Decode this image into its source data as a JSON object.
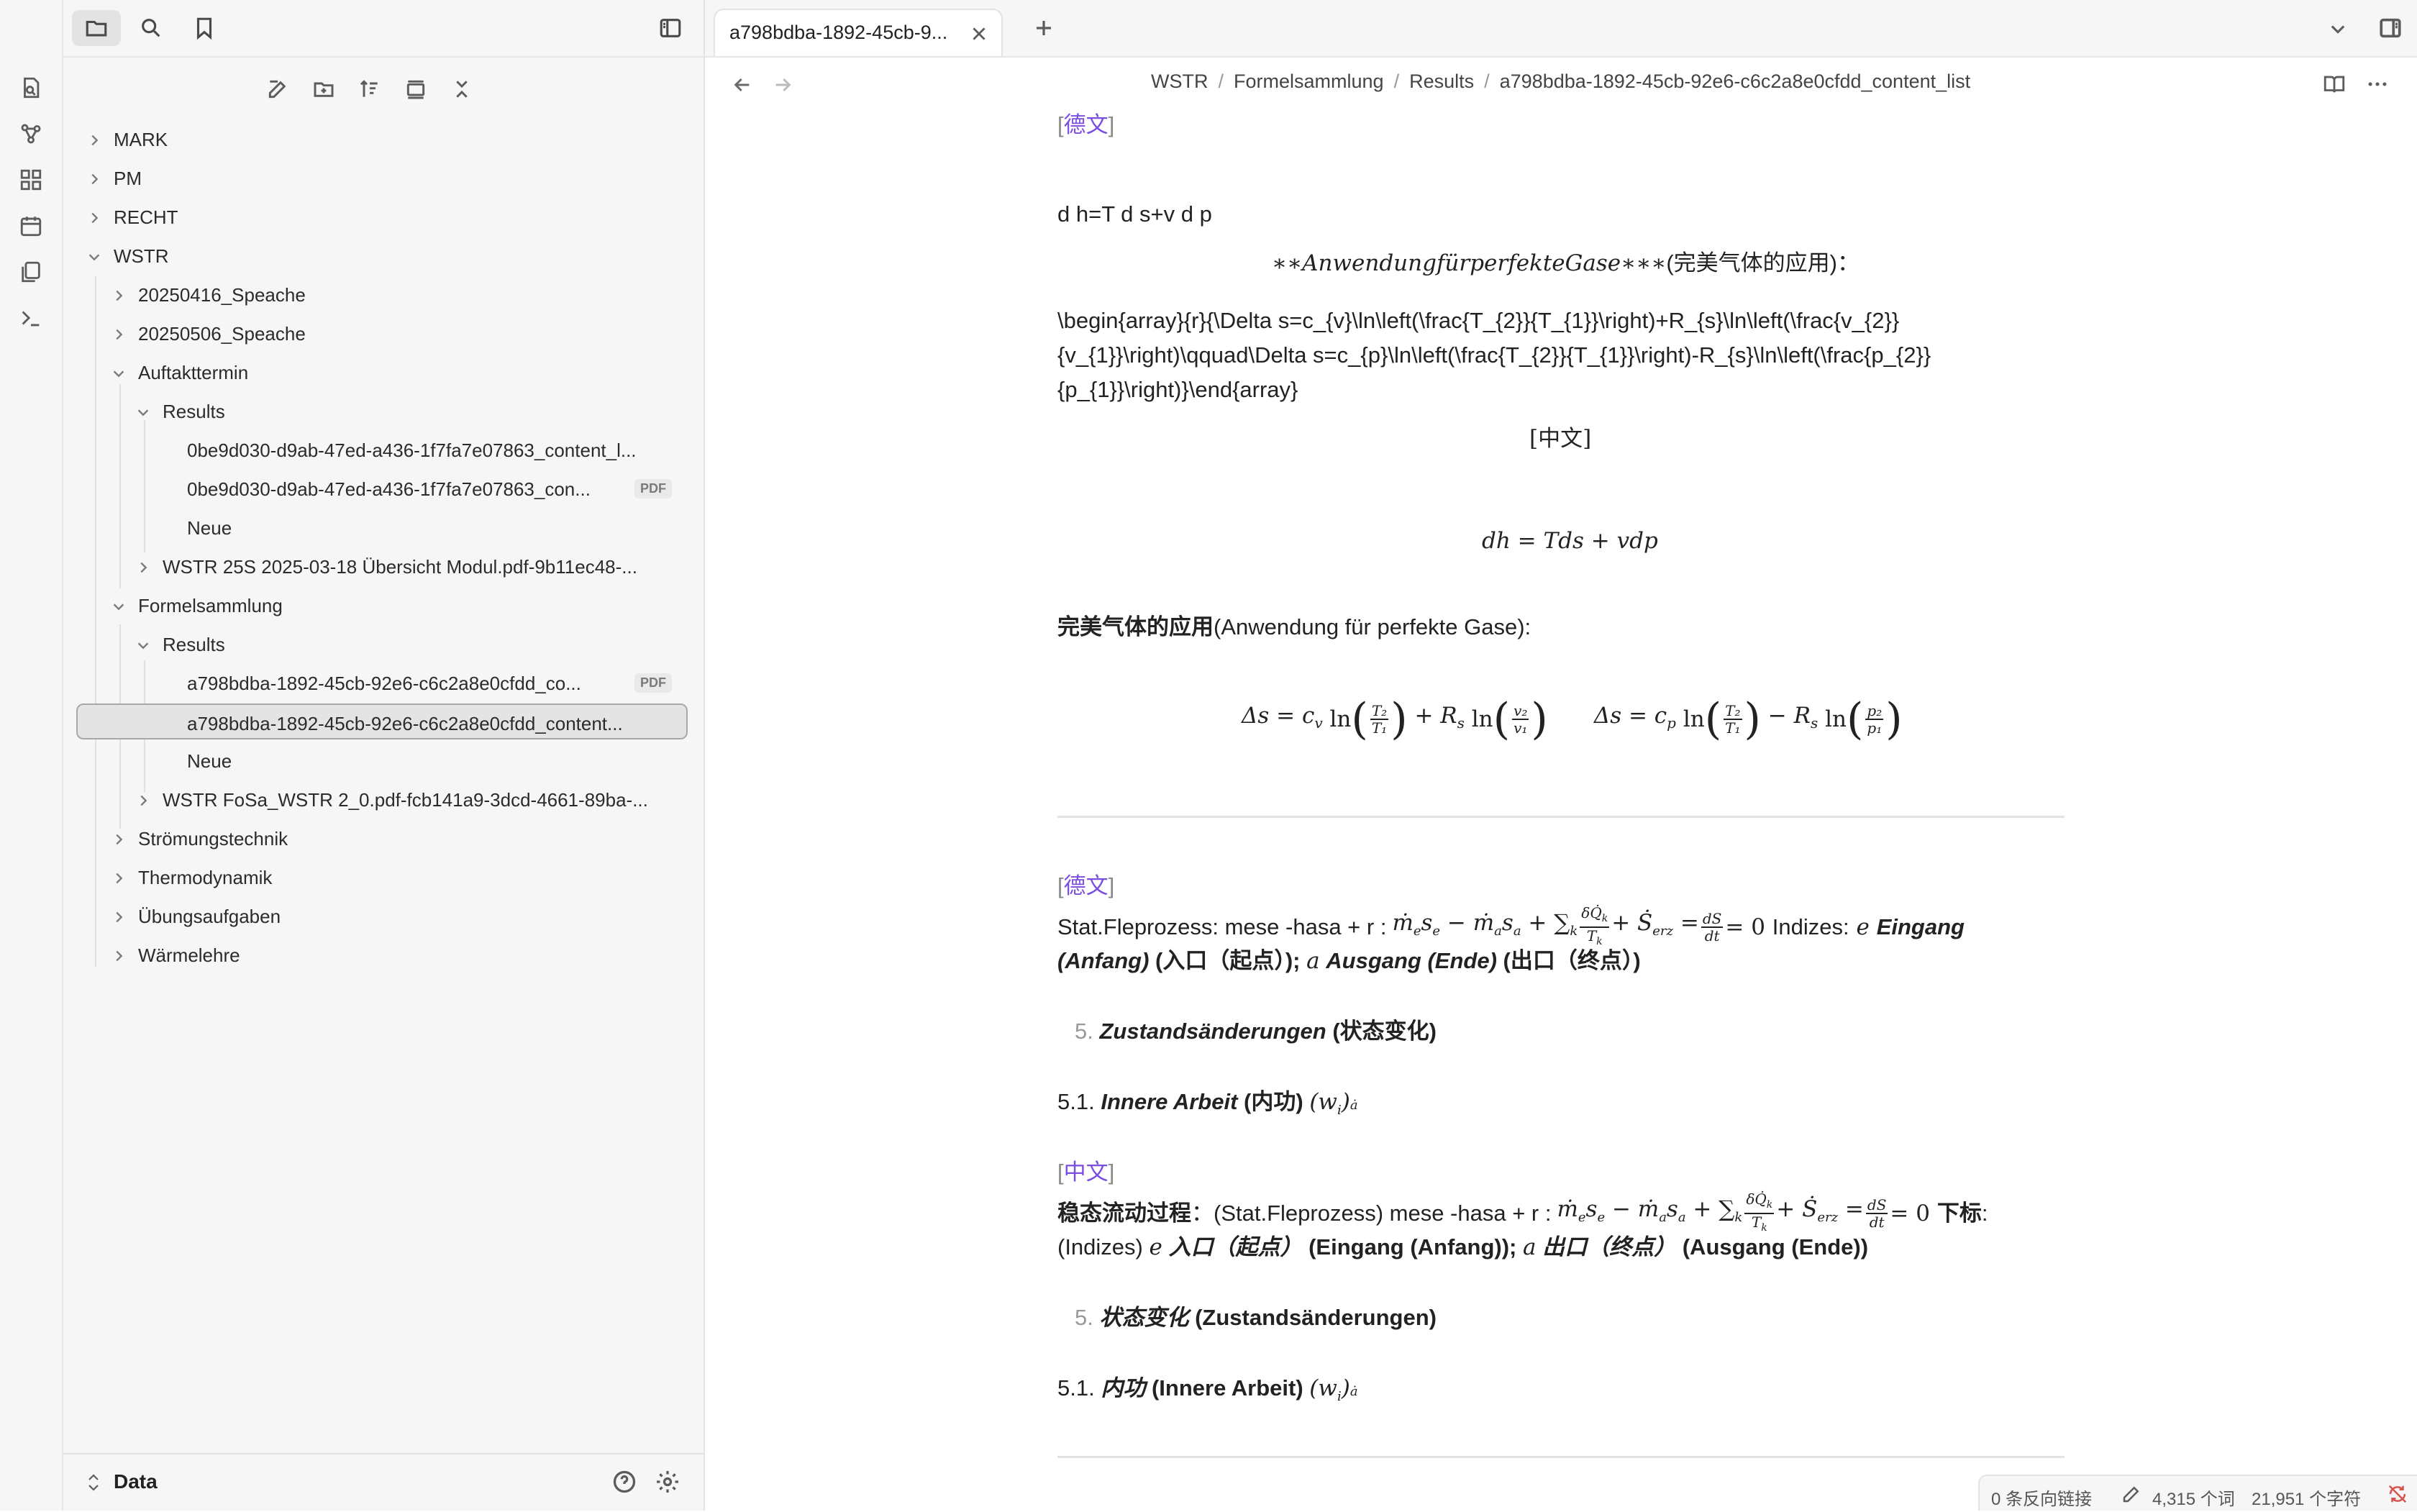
{
  "sidebar": {
    "tree": [
      {
        "label": "MARK"
      },
      {
        "label": "PM"
      },
      {
        "label": "RECHT"
      },
      {
        "label": "WSTR"
      },
      {
        "label": "20250416_Speache"
      },
      {
        "label": "20250506_Speache"
      },
      {
        "label": "Auftakttermin"
      },
      {
        "label": "Results"
      },
      {
        "label": "0be9d030-d9ab-47ed-a436-1f7fa7e07863_content_l..."
      },
      {
        "label": "0be9d030-d9ab-47ed-a436-1f7fa7e07863_con...",
        "badge": "PDF"
      },
      {
        "label": "Neue"
      },
      {
        "label": "WSTR 25S 2025-03-18 Übersicht Modul.pdf-9b11ec48-..."
      },
      {
        "label": "Formelsammlung"
      },
      {
        "label": "Results"
      },
      {
        "label": "a798bdba-1892-45cb-92e6-c6c2a8e0cfdd_co...",
        "badge": "PDF"
      },
      {
        "label": "a798bdba-1892-45cb-92e6-c6c2a8e0cfdd_content..."
      },
      {
        "label": "Neue"
      },
      {
        "label": "WSTR FoSa_WSTR 2_0.pdf-fcb141a9-3dcd-4661-89ba-..."
      },
      {
        "label": "Strömungstechnik"
      },
      {
        "label": "Thermodynamik"
      },
      {
        "label": "Übungsaufgaben"
      },
      {
        "label": "Wärmelehre"
      }
    ],
    "vault_name": "Data"
  },
  "tab": {
    "title": "a798bdba-1892-45cb-9..."
  },
  "breadcrumb": {
    "c1": "WSTR",
    "c2": "Formelsammlung",
    "c3": "Results",
    "c4": "a798bdba-1892-45cb-92e6-c6c2a8e0cfdd_content_list",
    "sep": "/"
  },
  "doc": {
    "de_link_1": "德文",
    "line_dh_raw": "d h=T d s+v d p",
    "line_anwendung_raw": "∗∗AnwendungfürperfekteGase∗∗∗",
    "line_anwendung_cn": "(完美气体的应用)：",
    "latex_1": "\\begin{array}{r}{\\Delta s=c_{v}\\ln\\left(\\frac{T_{2}}{T_{1}}\\right)+R_{s}\\ln\\left(\\frac{v_{2}}",
    "latex_2": "{v_{1}}\\right)\\qquad\\Delta s=c_{p}\\ln\\left(\\frac{T_{2}}{T_{1}}\\right)-R_{s}\\ln\\left(\\frac{p_{2}}",
    "latex_3": "{p_{1}}\\right)}\\end{array}",
    "cn_bracket_1": "中文",
    "eq_dh": "dh = Tds + vdp",
    "cn_perfect_gas_bold": "完美气体的应用",
    "cn_perfect_gas_de": "(Anwendung für perfekte Gase):",
    "de_link_2": "德文",
    "stat_prefix": "Stat.Fleprozess: mese -hasa + r :",
    "stat_indizes": "Indizes:",
    "stat_e_label": "Eingang",
    "stat_anfang": "(Anfang)",
    "stat_cn1": "(入口（起点）);",
    "stat_a_label": "Ausgang (Ende)",
    "stat_cn2": "(出口（终点）)",
    "list5_num": "5.",
    "list5_de": "Zustandsänderungen",
    "list5_cn": "(状态变化)",
    "sub51_num": "5.1.",
    "sub51_de": "Innere Arbeit",
    "sub51_cn": "(内功)",
    "cn_link_3": "中文",
    "cn_stat_bold": "稳态流动过程",
    "cn_stat_rest": "：(Stat.Fleprozess) mese -hasa + r :",
    "cn_stat_sub": "下标",
    "cn_stat_indizes": "(Indizes)",
    "cn_entry": "入口（起点）",
    "cn_entry_de": "(Eingang (Anfang));",
    "cn_exit": "出口（终点）",
    "cn_exit_de": "(Ausgang (Ende))",
    "list5b_cn": "状态变化",
    "list5b_de": "(Zustandsänderungen)",
    "sub51b_cn": "内功",
    "sub51b_de": "(Innere Arbeit)"
  },
  "status": {
    "backlinks": "0 条反向链接",
    "words": "4,315 个词",
    "chars": "21,951 个字符"
  }
}
